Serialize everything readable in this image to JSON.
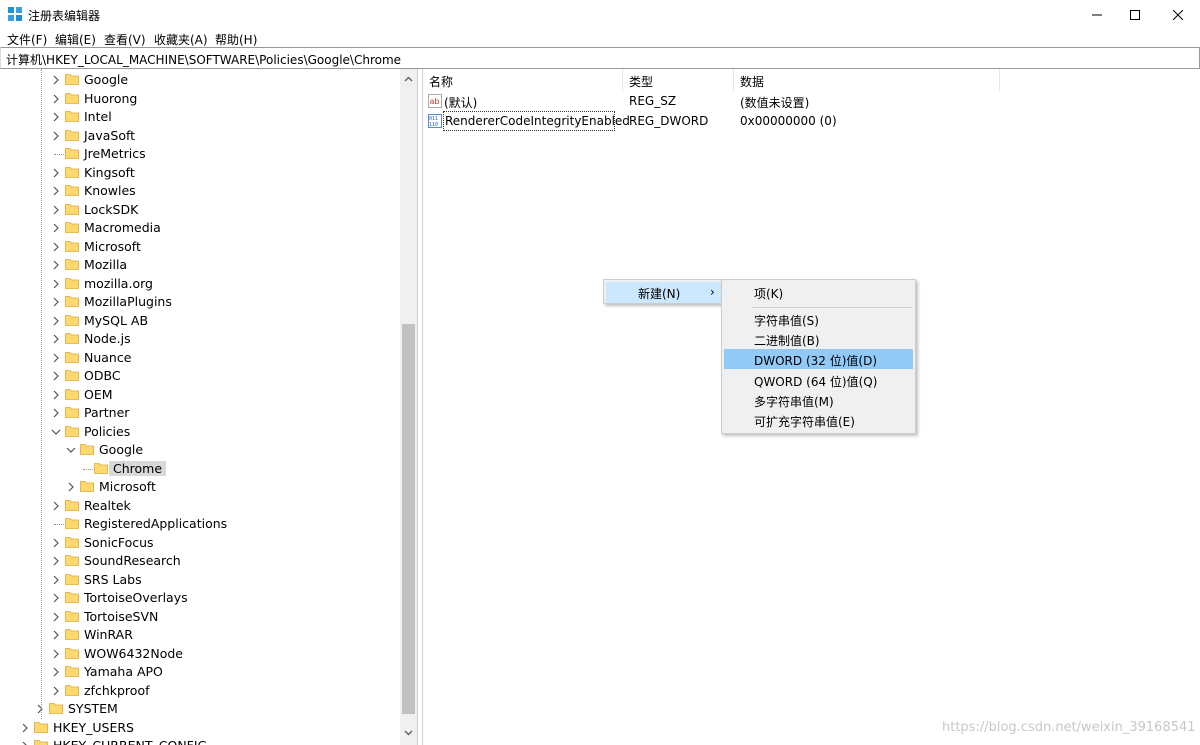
{
  "window": {
    "title": "注册表编辑器"
  },
  "menu": [
    {
      "label": "文件(F)"
    },
    {
      "label": "编辑(E)"
    },
    {
      "label": "查看(V)"
    },
    {
      "label": "收藏夹(A)"
    },
    {
      "label": "帮助(H)"
    }
  ],
  "address": "计算机\\HKEY_LOCAL_MACHINE\\SOFTWARE\\Policies\\Google\\Chrome",
  "tree": {
    "items": [
      {
        "label": "Google"
      },
      {
        "label": "Huorong"
      },
      {
        "label": "Intel"
      },
      {
        "label": "JavaSoft"
      },
      {
        "label": "JreMetrics"
      },
      {
        "label": "Kingsoft"
      },
      {
        "label": "Knowles"
      },
      {
        "label": "LockSDK"
      },
      {
        "label": "Macromedia"
      },
      {
        "label": "Microsoft"
      },
      {
        "label": "Mozilla"
      },
      {
        "label": "mozilla.org"
      },
      {
        "label": "MozillaPlugins"
      },
      {
        "label": "MySQL AB"
      },
      {
        "label": "Node.js"
      },
      {
        "label": "Nuance"
      },
      {
        "label": "ODBC"
      },
      {
        "label": "OEM"
      },
      {
        "label": "Partner"
      },
      {
        "label": "Policies"
      },
      {
        "label": "Google"
      },
      {
        "label": "Chrome"
      },
      {
        "label": "Microsoft"
      },
      {
        "label": "Realtek"
      },
      {
        "label": "RegisteredApplications"
      },
      {
        "label": "SonicFocus"
      },
      {
        "label": "SoundResearch"
      },
      {
        "label": "SRS Labs"
      },
      {
        "label": "TortoiseOverlays"
      },
      {
        "label": "TortoiseSVN"
      },
      {
        "label": "WinRAR"
      },
      {
        "label": "WOW6432Node"
      },
      {
        "label": "Yamaha APO"
      },
      {
        "label": "zfchkproof"
      },
      {
        "label": "SYSTEM"
      },
      {
        "label": "HKEY_USERS"
      },
      {
        "label": "HKEY_CURRENT_CONFIG"
      }
    ]
  },
  "list": {
    "headers": {
      "name": "名称",
      "type": "类型",
      "data": "数据"
    },
    "rows": [
      {
        "name": "(默认)",
        "type": "REG_SZ",
        "data": "(数值未设置)",
        "icon": "string-value-icon"
      },
      {
        "name": "RendererCodeIntegrityEnabled",
        "type": "REG_DWORD",
        "data": "0x00000000 (0)",
        "icon": "binary-value-icon"
      }
    ]
  },
  "context_menu": {
    "new_label": "新建(N)",
    "arrow": "›",
    "submenu": [
      {
        "label": "项(K)"
      },
      {
        "label": "字符串值(S)"
      },
      {
        "label": "二进制值(B)"
      },
      {
        "label": "DWORD (32 位)值(D)"
      },
      {
        "label": "QWORD (64 位)值(Q)"
      },
      {
        "label": "多字符串值(M)"
      },
      {
        "label": "可扩充字符串值(E)"
      }
    ]
  },
  "watermark": "https://blog.csdn.net/weixin_39168541",
  "colors": {
    "selection": "#cce8ff",
    "highlight": "#91c9f7",
    "folder": "#ffd86e"
  }
}
